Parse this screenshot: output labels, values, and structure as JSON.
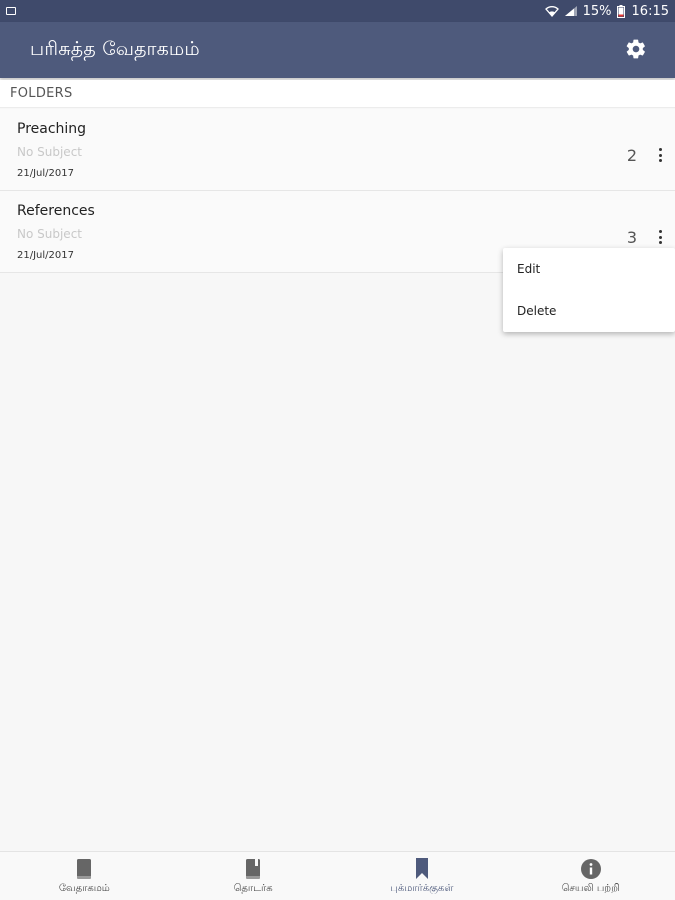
{
  "status_bar": {
    "battery": "15%",
    "time": "16:15",
    "icons": [
      "notification-icon",
      "wifi-icon",
      "signal-icon",
      "battery-icon"
    ]
  },
  "app_bar": {
    "title": "பரிசுத்த வேதாகமம்",
    "settings_icon": "gear-icon"
  },
  "section": {
    "header": "FOLDERS"
  },
  "folders": [
    {
      "name": "Preaching",
      "subject": "No Subject",
      "date": "21/Jul/2017",
      "count": "2"
    },
    {
      "name": "References",
      "subject": "No Subject",
      "date": "21/Jul/2017",
      "count": "3"
    }
  ],
  "popup_menu": {
    "items": [
      {
        "label": "Edit"
      },
      {
        "label": "Delete"
      }
    ]
  },
  "bottom_nav": {
    "items": [
      {
        "label": "வேதாகமம்",
        "icon": "book-icon",
        "active": false
      },
      {
        "label": "தொடர்க",
        "icon": "book-continue-icon",
        "active": false
      },
      {
        "label": "புக்மார்க்குகள்",
        "icon": "bookmark-icon",
        "active": true
      },
      {
        "label": "செயலி பற்றி",
        "icon": "info-icon",
        "active": false
      }
    ]
  },
  "colors": {
    "status_bar": "#3f4a6b",
    "app_bar": "#4e5a7c",
    "background": "#f7f7f7",
    "accent": "#4e5a7c"
  }
}
